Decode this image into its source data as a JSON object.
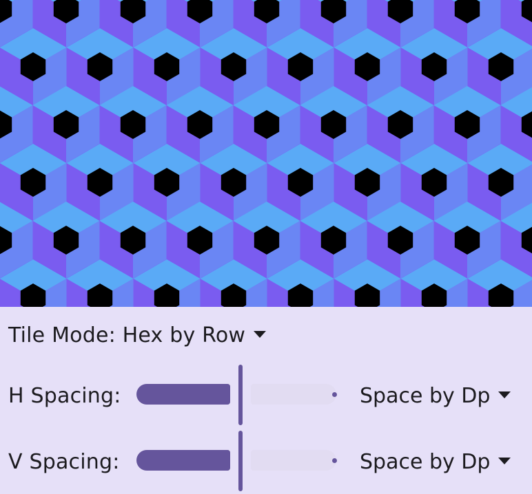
{
  "pattern": {
    "colors": {
      "base": "#7a5cf0",
      "light_face": "#5aaaf6",
      "mid_face": "#6a86f4",
      "hole": "#000000"
    }
  },
  "tile_mode": {
    "label": "Tile Mode:",
    "value": "Hex by Row"
  },
  "h_spacing": {
    "label": "H Spacing:",
    "value_fraction": 0.5,
    "mode": "Space by Dp"
  },
  "v_spacing": {
    "label": "V Spacing:",
    "value_fraction": 0.5,
    "mode": "Space by Dp"
  },
  "colors": {
    "panel_bg": "#e6e0f8",
    "accent": "#65559c",
    "track_inactive": "#e2dcf2",
    "text": "#1c1b1f"
  }
}
